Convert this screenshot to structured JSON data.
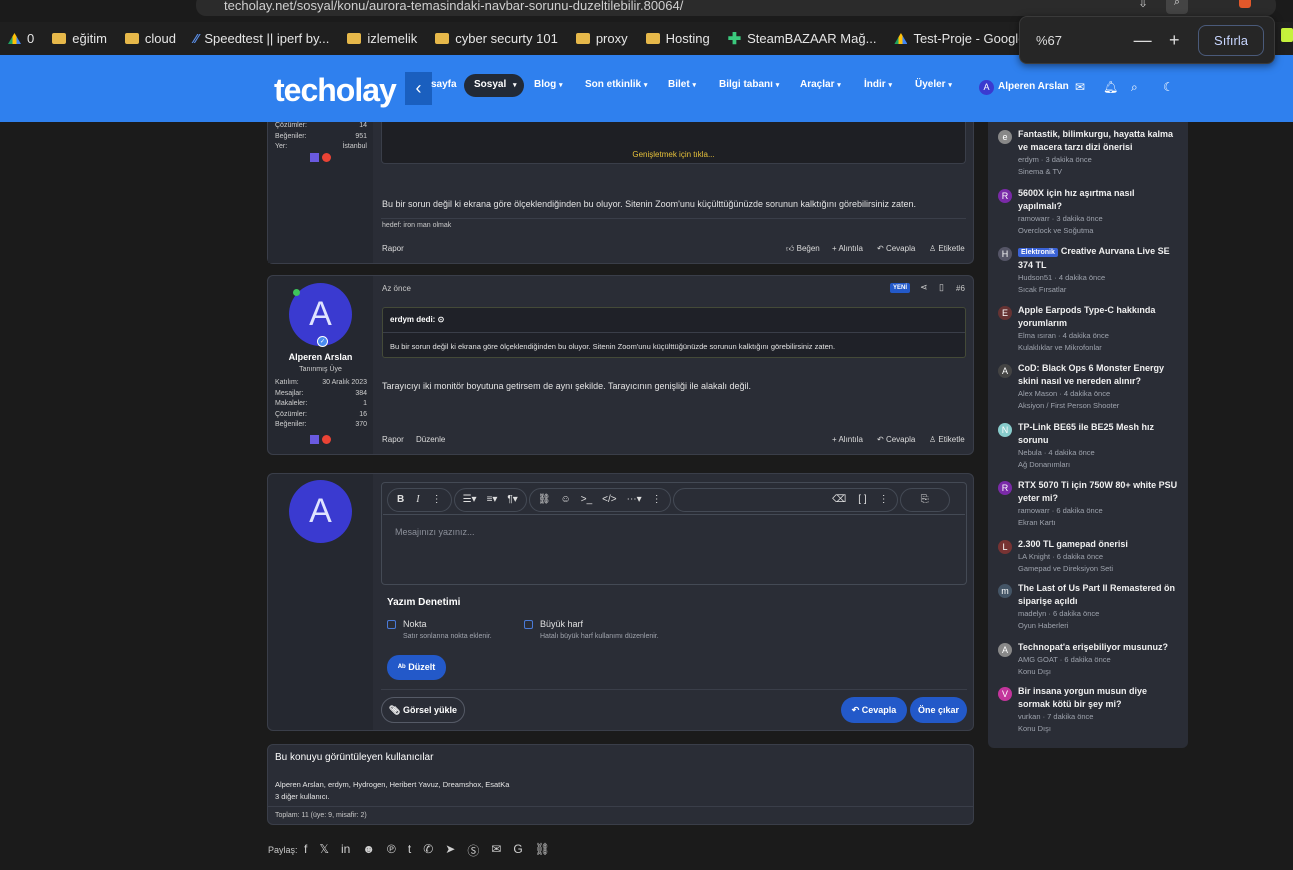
{
  "browser": {
    "url": "techolay.net/sosyal/konu/aurora-temasindaki-navbar-sorunu-duzeltilebilir.80064/",
    "bookmarks": [
      "0",
      "eğitim",
      "cloud",
      "Speedtest || iperf by...",
      "izlemelik",
      "cyber securty 101",
      "proxy",
      "Hosting",
      "SteamBAZAAR Mağ...",
      "Test-Proje - Google..."
    ],
    "zoom": {
      "value": "%67",
      "minus": "—",
      "plus": "+",
      "reset": "Sıfırla"
    }
  },
  "nav": {
    "logo": "techolay",
    "items": [
      "sayfa",
      "Sosyal",
      "Blog",
      "Son etkinlik",
      "Bilet",
      "Bilgi tabanı",
      "Araçlar",
      "İndir",
      "Üyeler"
    ],
    "user": "Alperen Arslan"
  },
  "post1": {
    "stats": [
      [
        "Çözümler:",
        "14"
      ],
      [
        "Beğeniler:",
        "951"
      ],
      [
        "Yer:",
        "İstanbul"
      ]
    ],
    "expand": "Genişletmek için tıkla...",
    "body": "Bu bir sorun değil ki ekrana göre ölçeklendiğinden bu oluyor. Sitenin Zoom'unu küçülttüğünüzde sorunun kalktığını görebilirsiniz zaten.",
    "signature": "hedef: iron man olmak",
    "report": "Rapor",
    "actions": [
      "Beğen",
      "Alıntıla",
      "Cevapla",
      "Etiketle"
    ]
  },
  "post2": {
    "avatar_letter": "A",
    "name": "Alperen Arslan",
    "role": "Tanınmış Üye",
    "stats": [
      [
        "Katılım:",
        "30 Aralık 2023"
      ],
      [
        "Mesajlar:",
        "384"
      ],
      [
        "Makaleler:",
        "1"
      ],
      [
        "Çözümler:",
        "16"
      ],
      [
        "Beğeniler:",
        "370"
      ]
    ],
    "time": "Az önce",
    "new": "YENİ",
    "num": "#6",
    "quote_author": "erdym dedi:",
    "quote_text": "Bu bir sorun değil ki ekrana göre ölçeklendiğinden bu oluyor. Sitenin Zoom'unu küçülttüğünüzde sorunun kalktığını görebilirsiniz zaten.",
    "body": "Tarayıcıyı iki monitör boyutuna getirsem de aynı şekilde. Tarayıcının genişliği ile alakalı değil.",
    "report": "Rapor",
    "edit": "Düzenle",
    "actions": [
      "Alıntıla",
      "Cevapla",
      "Etiketle"
    ]
  },
  "editor": {
    "avatar_letter": "A",
    "placeholder": "Mesajınızı yazınız...",
    "spell_title": "Yazım Denetimi",
    "opt1_label": "Nokta",
    "opt1_desc": "Satır sonlarına nokta eklenir.",
    "opt2_label": "Büyük harf",
    "opt2_desc": "Hatalı büyük harf kullanımı düzenlenir.",
    "fix": "Düzelt",
    "upload": "Görsel yükle",
    "reply": "Cevapla",
    "preview": "Öne çıkar"
  },
  "viewers": {
    "title": "Bu konuyu görüntüleyen kullanıcılar",
    "names": "Alperen Arslan, erdym, Hydrogen, Heribert Yavuz, Dreamshox, EsatKa",
    "others": "3 diğer kullanıcı.",
    "total": "Toplam: 11 (üye: 9, misafir: 2)"
  },
  "share": {
    "label": "Paylaş:"
  },
  "sidebar": [
    {
      "title": "Fantastik, bilimkurgu, hayatta kalma ve macera tarzı dizi önerisi",
      "meta": "erdym · 3 dakika önce",
      "forum": "Sinema & TV",
      "icon": "e",
      "color": "#888"
    },
    {
      "title": "5600X için hız aşırtma nasıl yapılmalı?",
      "meta": "ramowarr · 3 dakika önce",
      "forum": "Overclock ve Soğutma",
      "icon": "R",
      "color": "#7a2aa8"
    },
    {
      "title": "Creative Aurvana Live SE 374 TL",
      "badge": "Elektronik",
      "meta": "Hudson51 · 4 dakika önce",
      "forum": "Sıcak Fırsatlar",
      "icon": "H",
      "color": "#556"
    },
    {
      "title": "Apple Earpods Type-C hakkında yorumlarım",
      "meta": "Elma ısıran · 4 dakika önce",
      "forum": "Kulaklıklar ve Mikrofonlar",
      "icon": "E",
      "color": "#633"
    },
    {
      "title": "CoD: Black Ops 6 Monster Energy skini nasıl ve nereden alınır?",
      "meta": "Alex Mason · 4 dakika önce",
      "forum": "Aksiyon / First Person Shooter",
      "icon": "A",
      "color": "#444"
    },
    {
      "title": "TP-Link BE65 ile BE25 Mesh hız sorunu",
      "meta": "Nebula · 4 dakika önce",
      "forum": "Ağ Donanımları",
      "icon": "N",
      "color": "#8cc"
    },
    {
      "title": "RTX 5070 Ti için 750W 80+ white PSU yeter mi?",
      "meta": "ramowarr · 6 dakika önce",
      "forum": "Ekran Kartı",
      "icon": "R",
      "color": "#7a2aa8"
    },
    {
      "title": "2.300 TL gamepad önerisi",
      "meta": "LA Knight · 6 dakika önce",
      "forum": "Gamepad ve Direksiyon Seti",
      "icon": "L",
      "color": "#733"
    },
    {
      "title": "The Last of Us Part II Remastered ön siparişe açıldı",
      "meta": "madelyn · 6 dakika önce",
      "forum": "Oyun Haberleri",
      "icon": "m",
      "color": "#456"
    },
    {
      "title": "Technopat'a erişebiliyor musunuz?",
      "meta": "AMG GOAT · 6 dakika önce",
      "forum": "Konu Dışı",
      "icon": "A",
      "color": "#888"
    },
    {
      "title": "Bir insana yorgun musun diye sormak kötü bir şey mi?",
      "meta": "vurkan · 7 dakika önce",
      "forum": "Konu Dışı",
      "icon": "V",
      "color": "#c3359c"
    }
  ]
}
